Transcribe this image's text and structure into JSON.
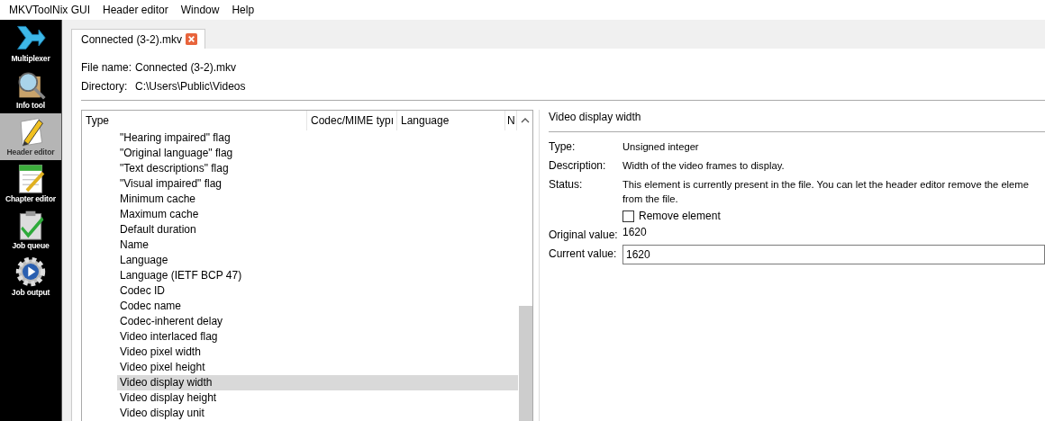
{
  "menu_bar": [
    {
      "label": "MKVToolNix GUI"
    },
    {
      "label": "Header editor"
    },
    {
      "label": "Window"
    },
    {
      "label": "Help"
    }
  ],
  "sidebar": {
    "items": [
      {
        "label": "Multiplexer",
        "kind": "merge",
        "selected": false
      },
      {
        "label": "Info tool",
        "kind": "info",
        "selected": false
      },
      {
        "label": "Header editor",
        "kind": "edit",
        "selected": true
      },
      {
        "label": "Chapter editor",
        "kind": "chapter",
        "selected": false
      },
      {
        "label": "Job queue",
        "kind": "queue",
        "selected": false
      },
      {
        "label": "Job output",
        "kind": "output",
        "selected": false
      }
    ]
  },
  "tabs": [
    {
      "label": "Connected (3-2).mkv",
      "selected": true
    }
  ],
  "file_info": [
    {
      "label": "File name:",
      "value": "Connected (3-2).mkv"
    },
    {
      "label": "Directory:",
      "value": "C:\\Users\\Public\\Videos"
    }
  ],
  "tree": {
    "columns": [
      "Type",
      "Codec/MIME typı",
      "Language",
      "N"
    ],
    "rows": [
      {
        "label": "\"Hearing impaired\" flag",
        "selected": false
      },
      {
        "label": "\"Original language\" flag",
        "selected": false
      },
      {
        "label": "\"Text descriptions\" flag",
        "selected": false
      },
      {
        "label": "\"Visual impaired\" flag",
        "selected": false
      },
      {
        "label": "Minimum cache",
        "selected": false
      },
      {
        "label": "Maximum cache",
        "selected": false
      },
      {
        "label": "Default duration",
        "selected": false
      },
      {
        "label": "Name",
        "selected": false
      },
      {
        "label": "Language",
        "selected": false
      },
      {
        "label": "Language (IETF BCP 47)",
        "selected": false
      },
      {
        "label": "Codec ID",
        "selected": false
      },
      {
        "label": "Codec name",
        "selected": false
      },
      {
        "label": "Codec-inherent delay",
        "selected": false
      },
      {
        "label": "Video interlaced flag",
        "selected": false
      },
      {
        "label": "Video pixel width",
        "selected": false
      },
      {
        "label": "Video pixel height",
        "selected": false
      },
      {
        "label": "Video display width",
        "selected": true
      },
      {
        "label": "Video display height",
        "selected": false
      },
      {
        "label": "Video display unit",
        "selected": false
      }
    ]
  },
  "details": {
    "title": "Video display width",
    "fields": [
      {
        "label": "Type:",
        "lines": [
          "Unsigned integer"
        ]
      },
      {
        "label": "Description:",
        "lines": [
          "Width of the video frames to display."
        ]
      },
      {
        "label": "Status:",
        "lines": [
          "This element is currently present in the file. You can let the header editor remove the eleme",
          "from the file."
        ]
      }
    ],
    "remove_element": {
      "label": "Remove element",
      "checked": false
    },
    "original_value": {
      "label": "Original value:",
      "value": "1620"
    },
    "current_value": {
      "label": "Current value:",
      "value": "1620"
    }
  }
}
